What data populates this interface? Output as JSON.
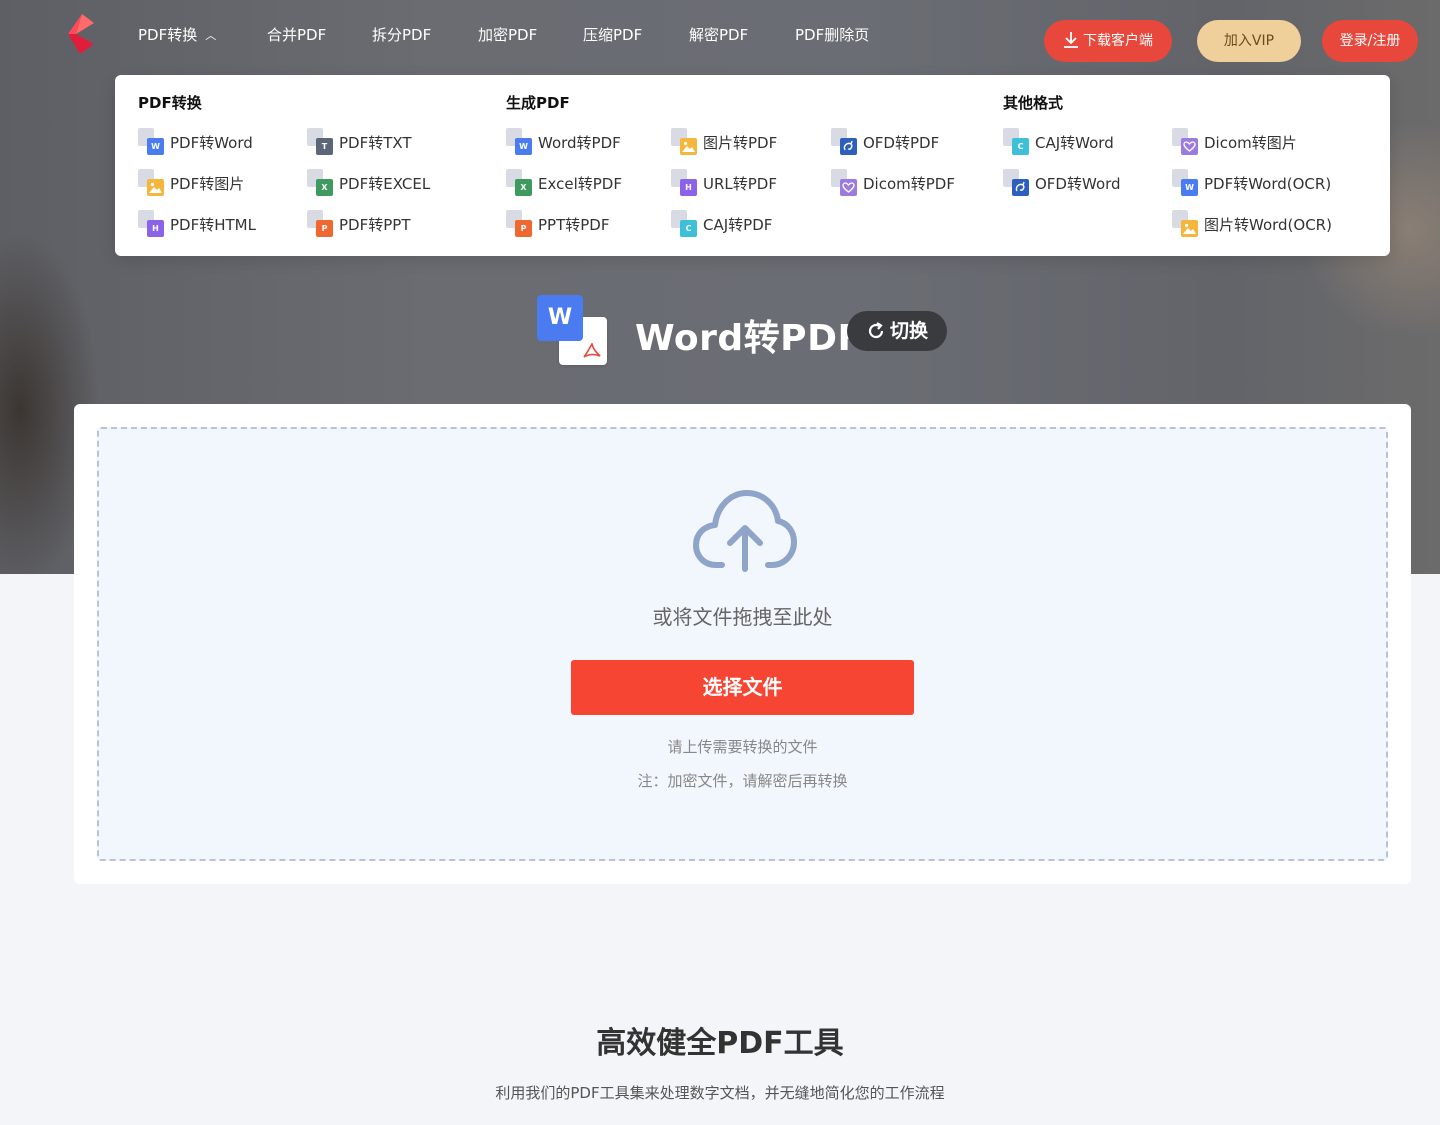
{
  "nav": {
    "items": [
      {
        "label": "PDF转换",
        "expanded": true
      },
      {
        "label": "合并PDF"
      },
      {
        "label": "拆分PDF"
      },
      {
        "label": "加密PDF"
      },
      {
        "label": "压缩PDF"
      },
      {
        "label": "解密PDF"
      },
      {
        "label": "PDF删除页"
      }
    ],
    "chevron": "chevron-up-icon",
    "download_label": "下载客户端",
    "vip_label": "加入VIP",
    "login_label": "登录/注册",
    "accent": "#e8473b",
    "vip_color": "#efcf9a"
  },
  "dropdown": {
    "sections": [
      {
        "title": "PDF转换"
      },
      {
        "title": "生成PDF"
      },
      {
        "title": "其他格式"
      }
    ],
    "items": [
      {
        "label": "PDF转Word",
        "icon": "pdf-to-word-icon",
        "badge": "W",
        "color": "#4a7bf0"
      },
      {
        "label": "PDF转TXT",
        "icon": "pdf-to-txt-icon",
        "badge": "T",
        "color": "#5b6677"
      },
      {
        "label": "PDF转图片",
        "icon": "pdf-to-image-icon",
        "badge": "",
        "color": "#f5b73b"
      },
      {
        "label": "PDF转EXCEL",
        "icon": "pdf-to-excel-icon",
        "badge": "X",
        "color": "#3e9a5e"
      },
      {
        "label": "PDF转HTML",
        "icon": "pdf-to-html-icon",
        "badge": "H",
        "color": "#8a63e8"
      },
      {
        "label": "PDF转PPT",
        "icon": "pdf-to-ppt-icon",
        "badge": "P",
        "color": "#f0672f"
      },
      {
        "label": "Word转PDF",
        "icon": "word-to-pdf-icon",
        "badge": "W",
        "color": "#4a7bf0"
      },
      {
        "label": "图片转PDF",
        "icon": "image-to-pdf-icon",
        "badge": "",
        "color": "#f5b73b"
      },
      {
        "label": "OFD转PDF",
        "icon": "ofd-to-pdf-icon",
        "badge": "ofd",
        "color": "#2d5fbf"
      },
      {
        "label": "Excel转PDF",
        "icon": "excel-to-pdf-icon",
        "badge": "X",
        "color": "#3e9a5e"
      },
      {
        "label": "URL转PDF",
        "icon": "url-to-pdf-icon",
        "badge": "H",
        "color": "#8a63e8"
      },
      {
        "label": "Dicom转PDF",
        "icon": "dicom-to-pdf-icon",
        "badge": "heart",
        "color": "#9b7be0"
      },
      {
        "label": "PPT转PDF",
        "icon": "ppt-to-pdf-icon",
        "badge": "P",
        "color": "#f0672f"
      },
      {
        "label": "CAJ转PDF",
        "icon": "caj-to-pdf-icon",
        "badge": "C",
        "color": "#3ec0d8"
      },
      {
        "label": "CAJ转Word",
        "icon": "caj-to-word-icon",
        "badge": "C",
        "color": "#3ec0d8"
      },
      {
        "label": "Dicom转图片",
        "icon": "dicom-to-image-icon",
        "badge": "heart",
        "color": "#9b7be0"
      },
      {
        "label": "OFD转Word",
        "icon": "ofd-to-word-icon",
        "badge": "ofd",
        "color": "#2d5fbf"
      },
      {
        "label": "PDF转Word(OCR)",
        "icon": "pdf-to-word-ocr-icon",
        "badge": "W",
        "color": "#4a7bf0"
      },
      {
        "label": "图片转Word(OCR)",
        "icon": "image-to-word-ocr-icon",
        "badge": "",
        "color": "#f5b73b"
      }
    ]
  },
  "tool": {
    "title": "Word转PDF",
    "icon_letter": "W",
    "switch_label": "切换"
  },
  "upload": {
    "drop_text": "或将文件拖拽至此处",
    "select_label": "选择文件",
    "hint1": "请上传需要转换的文件",
    "hint2": "注：加密文件，请解密后再转换",
    "button_color": "#f64532"
  },
  "section": {
    "title": "高效健全PDF工具",
    "subtitle": "利用我们的PDF工具集来处理数字文档，并无缝地简化您的工作流程"
  }
}
